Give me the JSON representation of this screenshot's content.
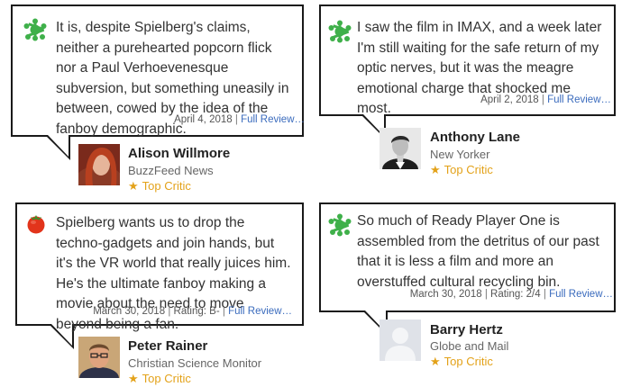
{
  "reviews": [
    {
      "quote": "It is, despite Spielberg's claims, neither a purehearted popcorn flick nor a Paul Verhoevenesque subversion, but something uneasily in between, cowed by the idea of the fanboy demographic.",
      "date": "April 4, 2018",
      "rating": "",
      "link": "Full Review…",
      "icon": "rotten-splat-icon",
      "critic_name": "Alison Willmore",
      "publication": "BuzzFeed News",
      "badge": "Top Critic"
    },
    {
      "quote": "I saw the film in IMAX, and a week later I'm still waiting for the safe return of my optic nerves, but it was the meagre emotional charge that shocked me most.",
      "date": "April 2, 2018",
      "rating": "",
      "link": "Full Review…",
      "icon": "rotten-splat-icon",
      "critic_name": "Anthony Lane",
      "publication": "New Yorker",
      "badge": "Top Critic"
    },
    {
      "quote": "Spielberg wants us to drop the techno-gadgets and join hands, but it's the VR world that really juices him. He's the ultimate fanboy making a movie about the need to move beyond being a fan.",
      "date": "March 30, 2018",
      "rating": "Rating: B-",
      "link": "Full Review…",
      "icon": "fresh-tomato-icon",
      "critic_name": "Peter Rainer",
      "publication": "Christian Science Monitor",
      "badge": "Top Critic"
    },
    {
      "quote": "So much of Ready Player One is assembled from the detritus of our past that it is less a film and more an overstuffed cultural recycling bin.",
      "date": "March 30, 2018",
      "rating": "Rating: 2/4",
      "link": "Full Review…",
      "icon": "rotten-splat-icon",
      "critic_name": "Barry Hertz",
      "publication": "Globe and Mail",
      "badge": "Top Critic"
    }
  ],
  "colors": {
    "splat": "#3fb04a",
    "tomato": "#e2341b",
    "link": "#3a6bbd",
    "top_critic": "#e3a21a"
  }
}
